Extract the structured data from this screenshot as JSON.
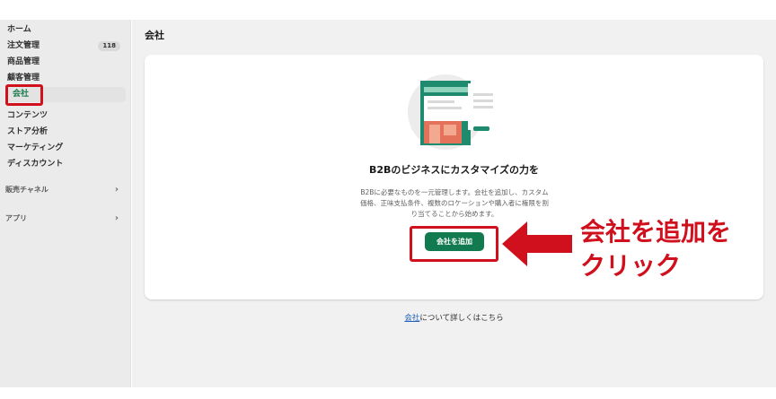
{
  "sidebar": {
    "items": [
      {
        "label": "ホーム"
      },
      {
        "label": "注文管理",
        "badge": "118"
      },
      {
        "label": "商品管理"
      },
      {
        "label": "顧客管理"
      },
      {
        "label": "会社",
        "active": true
      },
      {
        "label": "コンテンツ"
      },
      {
        "label": "ストア分析"
      },
      {
        "label": "マーケティング"
      },
      {
        "label": "ディスカウント"
      }
    ],
    "sections": [
      {
        "label": "販売チャネル",
        "icon": "chevron-right-icon"
      },
      {
        "label": "アプリ",
        "icon": "chevron-right-icon"
      }
    ]
  },
  "main": {
    "title": "会社",
    "empty_state": {
      "heading": "B2Bのビジネスにカスタマイズの力を",
      "description_lines": [
        "B2Bに必要なものを一元管理します。会社を追加し、カスタム",
        "価格、正味支払条件、複数のロケーションや購入者に権限を割",
        "り当てることから始めます。"
      ],
      "button_label": "会社を追加"
    },
    "learn_more": {
      "link": "会社",
      "text": "について詳しくはこちら"
    }
  },
  "annotation": {
    "lines": [
      "会社を追加を",
      "クリック"
    ],
    "color": "#d0101c"
  },
  "colors": {
    "accent": "#127a4f",
    "link": "#2463bc",
    "highlight": "#d0101c"
  }
}
